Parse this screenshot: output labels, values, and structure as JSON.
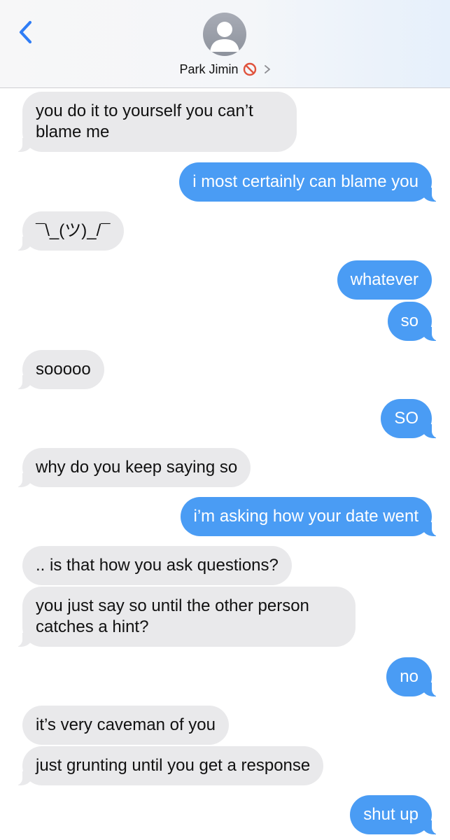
{
  "header": {
    "contact_name": "Park Jimin",
    "back_icon": "chevron-left-icon",
    "avatar_icon": "person-placeholder-icon",
    "status_icon": "no-entry-icon",
    "detail_icon": "chevron-right-icon"
  },
  "colors": {
    "incoming_bubble": "#e9e9eb",
    "outgoing_bubble": "#4a9cf4",
    "accent": "#2f7df6"
  },
  "messages": [
    {
      "from": "them",
      "text": "you do it to yourself you can’t blame me"
    },
    {
      "from": "me",
      "text": "i most certainly can blame you"
    },
    {
      "from": "them",
      "text": "¯\\_(ツ)_/¯"
    },
    {
      "from": "me",
      "text": "whatever"
    },
    {
      "from": "me",
      "text": "so"
    },
    {
      "from": "them",
      "text": "sooooo"
    },
    {
      "from": "me",
      "text": "SO"
    },
    {
      "from": "them",
      "text": "why do you keep saying so"
    },
    {
      "from": "me",
      "text": "i’m asking how your date went"
    },
    {
      "from": "them",
      "text": ".. is that how you ask questions?"
    },
    {
      "from": "them",
      "text": "you just say so until the other person catches a hint?"
    },
    {
      "from": "me",
      "text": "no"
    },
    {
      "from": "them",
      "text": "it’s very caveman of you"
    },
    {
      "from": "them",
      "text": "just grunting until you get a response"
    },
    {
      "from": "me",
      "text": "shut up"
    }
  ]
}
